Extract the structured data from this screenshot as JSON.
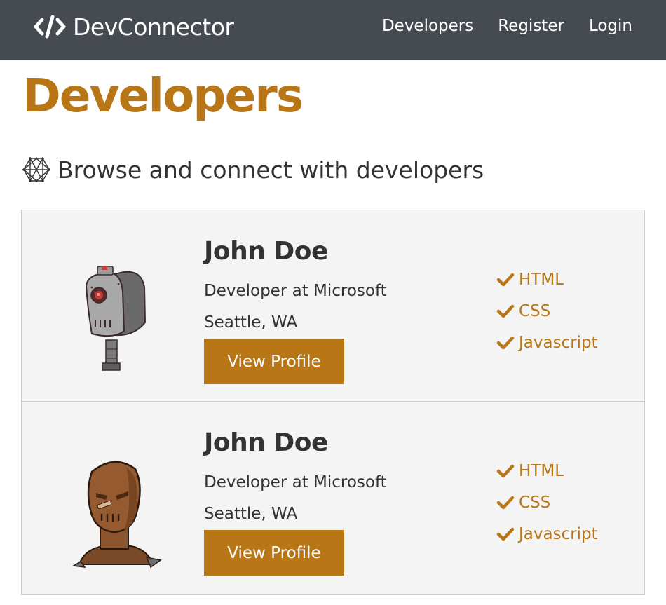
{
  "navbar": {
    "brand": "DevConnector",
    "brand_icon": "code-icon",
    "links": [
      {
        "label": "Developers"
      },
      {
        "label": "Register"
      },
      {
        "label": "Login"
      }
    ]
  },
  "page": {
    "title": "Developers",
    "lead": "Browse and connect with developers",
    "lead_icon": "connectdevelop-icon"
  },
  "profiles": [
    {
      "avatar": "robot-avatar-gray",
      "name": "John Doe",
      "status": "Developer at Microsoft",
      "location": "Seattle, WA",
      "button_label": "View Profile",
      "skills": [
        "HTML",
        "CSS",
        "Javascript"
      ]
    },
    {
      "avatar": "robot-avatar-brown",
      "name": "John Doe",
      "status": "Developer at Microsoft",
      "location": "Seattle, WA",
      "button_label": "View Profile",
      "skills": [
        "HTML",
        "CSS",
        "Javascript"
      ]
    }
  ],
  "colors": {
    "navbar_bg": "#464b51",
    "accent": "#b87616",
    "card_bg": "#f4f4f4",
    "text": "#333333"
  }
}
